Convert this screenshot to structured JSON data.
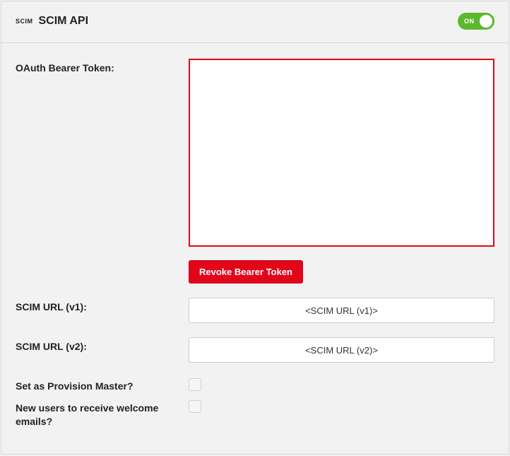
{
  "header": {
    "badge": "SCIM",
    "title": "SCIM API",
    "toggle_label": "ON",
    "toggle_on": true
  },
  "form": {
    "oauth_label": "OAuth Bearer Token:",
    "oauth_value": "",
    "revoke_label": "Revoke Bearer Token",
    "scim_v1_label": "SCIM URL (v1):",
    "scim_v1_value": "<SCIM URL (v1)>",
    "scim_v2_label": "SCIM URL (v2):",
    "scim_v2_value": "<SCIM URL (v2)>",
    "provision_master_label": "Set as Provision Master?",
    "provision_master_checked": false,
    "welcome_emails_label": "New users to receive welcome emails?",
    "welcome_emails_checked": false
  }
}
